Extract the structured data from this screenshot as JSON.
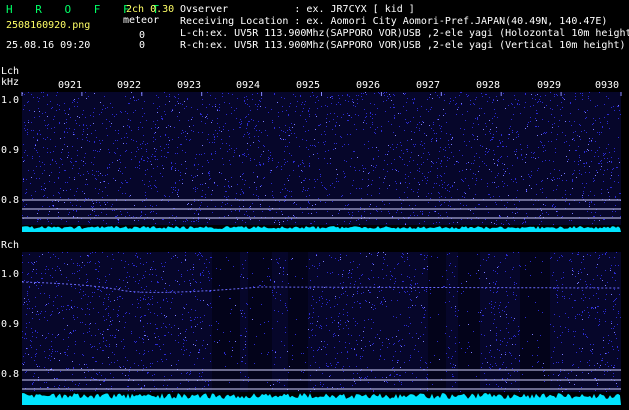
{
  "header": {
    "app_title": "H R O F F T",
    "mode": "2ch 0.30",
    "filename": "2508160920.png",
    "meteor_label": "meteor",
    "lch_count": "0",
    "rch_count": "0",
    "datetime": "25.08.16 09:20"
  },
  "info": {
    "observer": "Ovserver           : ex. JR7CYX [ kid ]",
    "location": "Receiving Location : ex. Aomori City Aomori-Pref.JAPAN(40.49N, 140.47E)",
    "lch": "L-ch:ex. UV5R 113.900Mhz(SAPPORO VOR)USB ,2-ele yagi (Holozontal 10m height)",
    "rch": "R-ch:ex. UV5R 113.900Mhz(SAPPORO VOR)USB ,2-ele yagi (Vertical 10m height)"
  },
  "lch_panel": {
    "label": "Lch",
    "unit": "kHz",
    "yticks": [
      "1.0",
      "0.9",
      "0.8"
    ],
    "xticks": [
      "0921",
      "0922",
      "0923",
      "0924",
      "0925",
      "0926",
      "0927",
      "0928",
      "0929",
      "0930"
    ]
  },
  "rch_panel": {
    "label": "Rch",
    "yticks": [
      "1.0",
      "0.9",
      "0.8"
    ]
  },
  "colors": {
    "spectrogram_bg": "#06062a",
    "noise": "#2a2ad0",
    "level_bar": "#00e5ff",
    "ref_line": "#d0d0ff",
    "title_green": "#00ff66",
    "yellow": "#ffff66"
  }
}
